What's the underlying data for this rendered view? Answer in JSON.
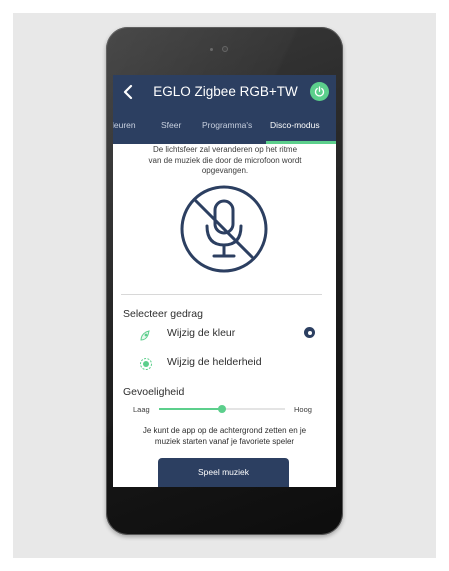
{
  "header": {
    "title": "EGLO Zigbee RGB+TW",
    "back_icon": "chevron-left-icon",
    "power_icon": "power-icon",
    "power_color": "#5ccf8c",
    "bar_color": "#2c3f61"
  },
  "tabs": [
    {
      "label": "leuren",
      "active": false
    },
    {
      "label": "Sfeer",
      "active": false
    },
    {
      "label": "Programma's",
      "active": false
    },
    {
      "label": "Disco-modus",
      "active": true
    }
  ],
  "description": {
    "line1": "De lichtsfeer zal veranderen op het ritme",
    "line2": "van de muziek die door de microfoon wordt",
    "line3": "opgevangen."
  },
  "mic_icon": "microphone-off-icon",
  "behavior": {
    "heading": "Selecteer gedrag",
    "options": [
      {
        "label": "Wijzig de kleur",
        "icon": "color-drop-icon",
        "selected": true
      },
      {
        "label": "Wijzig de helderheid",
        "icon": "brightness-icon",
        "selected": false
      }
    ]
  },
  "sensitivity": {
    "heading": "Gevoeligheid",
    "low_label": "Laag",
    "high_label": "Hoog",
    "value_fraction": 0.5
  },
  "background_note": {
    "line1": "Je kunt de app op de achtergrond zetten en je",
    "line2": "muziek starten vanaf je favoriete speler"
  },
  "play_button": "Speel muziek"
}
